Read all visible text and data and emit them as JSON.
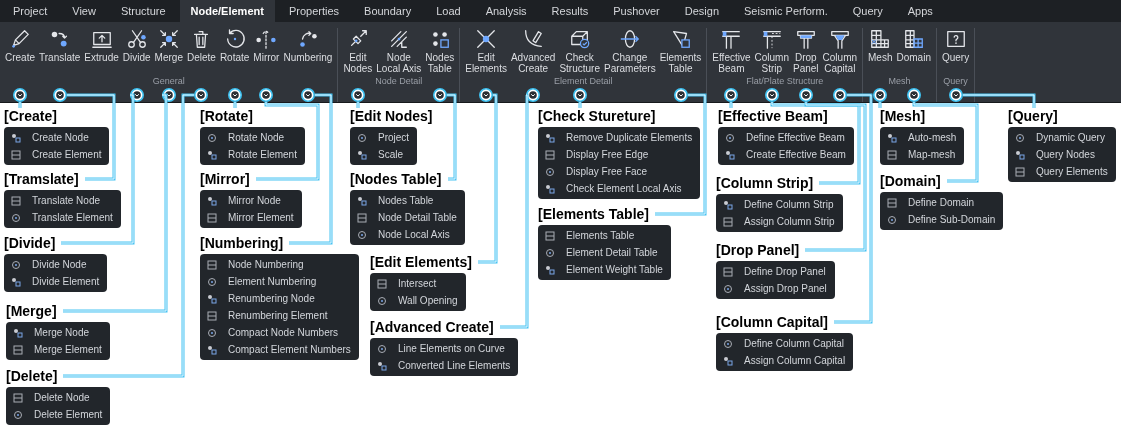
{
  "tabs": [
    {
      "label": "Project",
      "selected": false
    },
    {
      "label": "View",
      "selected": false
    },
    {
      "label": "Structure",
      "selected": false
    },
    {
      "label": "Node/Element",
      "selected": true
    },
    {
      "label": "Properties",
      "selected": false
    },
    {
      "label": "Boundary",
      "selected": false
    },
    {
      "label": "Load",
      "selected": false
    },
    {
      "label": "Analysis",
      "selected": false
    },
    {
      "label": "Results",
      "selected": false
    },
    {
      "label": "Pushover",
      "selected": false
    },
    {
      "label": "Design",
      "selected": false
    },
    {
      "label": "Seismic Perform.",
      "selected": false
    },
    {
      "label": "Query",
      "selected": false
    },
    {
      "label": "Apps",
      "selected": false
    }
  ],
  "ribbon_groups": [
    {
      "label": "General",
      "buttons": [
        {
          "label": "Create",
          "menu": {
            "title": "[Create]",
            "items": [
              "Create Node",
              "Create Element"
            ]
          }
        },
        {
          "label": "Translate",
          "menu": {
            "title": "[Tramslate]",
            "items": [
              "Translate Node",
              "Translate Element"
            ]
          }
        },
        {
          "label": "Extrude"
        },
        {
          "label": "Divide",
          "menu": {
            "title": "[Divide]",
            "items": [
              "Divide Node",
              "Divide Element"
            ]
          }
        },
        {
          "label": "Merge",
          "menu": {
            "title": "[Merge]",
            "items": [
              "Merge Node",
              "Merge Element"
            ]
          }
        },
        {
          "label": "Delete",
          "menu": {
            "title": "[Delete]",
            "items": [
              "Delete Node",
              "Delete Element"
            ]
          }
        },
        {
          "label": "Rotate",
          "menu": {
            "title": "[Rotate]",
            "items": [
              "Rotate Node",
              "Rotate Element"
            ]
          }
        },
        {
          "label": "Mirror",
          "menu": {
            "title": "[Mirror]",
            "items": [
              "Mirror Node",
              "Mirror Element"
            ]
          }
        },
        {
          "label": "Numbering",
          "menu": {
            "title": "[Numbering]",
            "items": [
              "Node Numbering",
              "Element Numbering",
              "Renumbering Node",
              "Renumbering Element",
              "Compact Node Numbers",
              "Compact Element Numbers"
            ]
          }
        }
      ]
    },
    {
      "label": "Node Detail",
      "buttons": [
        {
          "label": "Edit\nNodes",
          "menu": {
            "title": "[Edit Nodes]",
            "items": [
              "Project",
              "Scale"
            ]
          }
        },
        {
          "label": "Node\nLocal Axis"
        },
        {
          "label": "Nodes\nTable",
          "menu": {
            "title": "[Nodes Table]",
            "items": [
              "Nodes Table",
              "Node Detail Table",
              "Node Local Axis"
            ]
          }
        }
      ]
    },
    {
      "label": "Element Detail",
      "buttons": [
        {
          "label": "Edit\nElements",
          "menu": {
            "title": "[Edit Elements]",
            "items": [
              "Intersect",
              "Wall Opening"
            ]
          }
        },
        {
          "label": "Advanced\nCreate",
          "menu": {
            "title": "[Advanced Create]",
            "items": [
              "Line Elements on Curve",
              "Converted Line Elements"
            ]
          }
        },
        {
          "label": "Check\nStructure",
          "menu": {
            "title": "[Check Stureture]",
            "items": [
              "Remove Duplicate Elements",
              "Display Free Edge",
              "Display Free Face",
              "Check Element Local Axis"
            ]
          }
        },
        {
          "label": "Change\nParameters"
        },
        {
          "label": "Elements\nTable",
          "menu": {
            "title": "[Elements Table]",
            "items": [
              "Elements Table",
              "Element Detail Table",
              "Element Weight Table"
            ]
          }
        }
      ]
    },
    {
      "label": "Flat/Plate Structure",
      "buttons": [
        {
          "label": "Effective\nBeam",
          "menu": {
            "title": "[Effective Beam]",
            "items": [
              "Define Effective Beam",
              "Create Effective Beam"
            ]
          }
        },
        {
          "label": "Column\nStrip",
          "menu": {
            "title": "[Column Strip]",
            "items": [
              "Define Column Strip",
              "Assign Column Strip"
            ]
          }
        },
        {
          "label": "Drop\nPanel",
          "menu": {
            "title": "[Drop Panel]",
            "items": [
              "Define Drop Panel",
              "Assign Drop Panel"
            ]
          }
        },
        {
          "label": "Column\nCapital",
          "menu": {
            "title": "[Column Capital]",
            "items": [
              "Define Column Capital",
              "Assign Column Capital"
            ]
          }
        }
      ]
    },
    {
      "label": "Mesh",
      "buttons": [
        {
          "label": "Mesh",
          "menu": {
            "title": "[Mesh]",
            "items": [
              "Auto-mesh",
              "Map-mesh"
            ]
          }
        },
        {
          "label": "Domain",
          "menu": {
            "title": "[Domain]",
            "items": [
              "Define Domain",
              "Define Sub-Domain"
            ]
          }
        }
      ]
    },
    {
      "label": "Query",
      "buttons": [
        {
          "label": "Query",
          "menu": {
            "title": "[Query]",
            "items": [
              "Dynamic Query",
              "Query Nodes",
              "Query Elements"
            ]
          }
        }
      ]
    }
  ]
}
